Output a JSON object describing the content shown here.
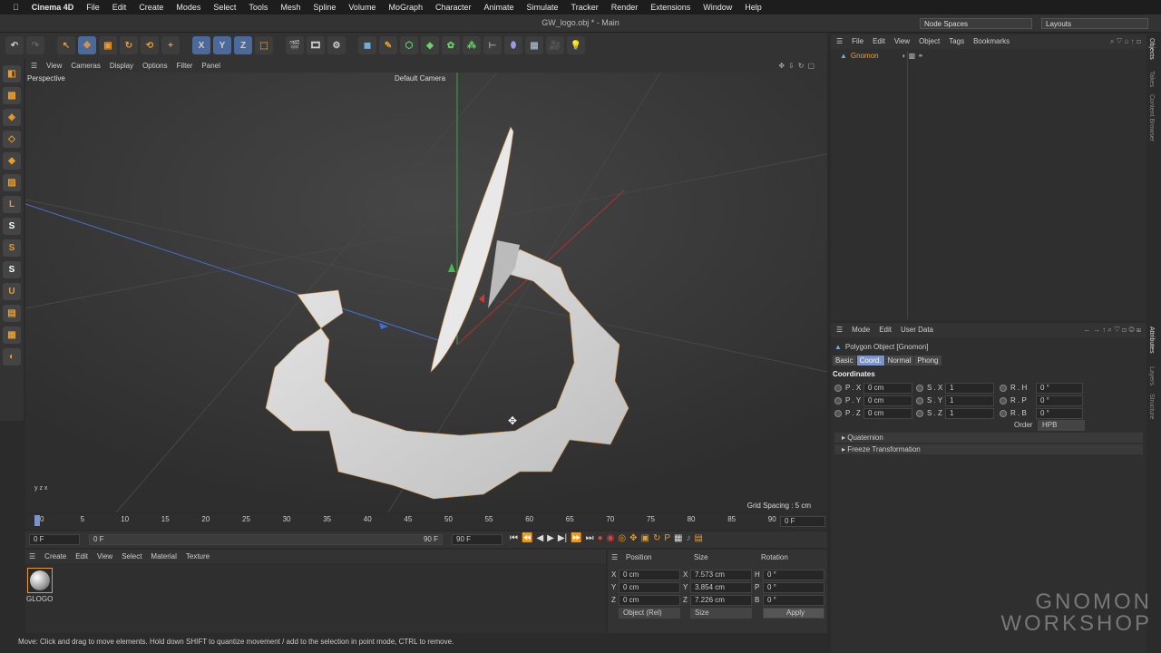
{
  "mac_menu": {
    "app": "Cinema 4D",
    "items": [
      "File",
      "Edit",
      "Create",
      "Modes",
      "Select",
      "Tools",
      "Mesh",
      "Spline",
      "Volume",
      "MoGraph",
      "Character",
      "Animate",
      "Simulate",
      "Tracker",
      "Render",
      "Extensions",
      "Window",
      "Help"
    ]
  },
  "window": {
    "title": "GW_logo.obj * - Main",
    "node_spaces": "Node Spaces",
    "layouts": "Layouts"
  },
  "toolbar": {
    "axis_labels": [
      "X",
      "Y",
      "Z"
    ]
  },
  "viewport": {
    "menu": [
      "View",
      "Cameras",
      "Display",
      "Options",
      "Filter",
      "Panel"
    ],
    "view_name": "Perspective",
    "camera": "Default Camera",
    "grid_spacing": "Grid Spacing : 5 cm"
  },
  "timeline": {
    "ticks": [
      "0",
      "5",
      "10",
      "15",
      "20",
      "25",
      "30",
      "35",
      "40",
      "45",
      "50",
      "55",
      "60",
      "65",
      "70",
      "75",
      "80",
      "85",
      "90"
    ],
    "current_frame": "0 F",
    "start": "0 F",
    "range_start": "0 F",
    "range_end": "90 F",
    "end": "90 F"
  },
  "material_manager": {
    "menu": [
      "Create",
      "Edit",
      "View",
      "Select",
      "Material",
      "Texture"
    ],
    "materials": [
      {
        "name": "GLOGO"
      }
    ]
  },
  "coordinates": {
    "headers": [
      "Position",
      "Size",
      "Rotation"
    ],
    "rows": [
      {
        "axis": "X",
        "pos": "0 cm",
        "size_axis": "X",
        "size": "7.573 cm",
        "rot_axis": "H",
        "rot": "0 °"
      },
      {
        "axis": "Y",
        "pos": "0 cm",
        "size_axis": "Y",
        "size": "3.854 cm",
        "rot_axis": "P",
        "rot": "0 °"
      },
      {
        "axis": "Z",
        "pos": "0 cm",
        "size_axis": "Z",
        "size": "7.226 cm",
        "rot_axis": "B",
        "rot": "0 °"
      }
    ],
    "mode": "Object (Rel)",
    "size_mode": "Size",
    "apply": "Apply"
  },
  "status": "Move: Click and drag to move elements. Hold down SHIFT to quantize movement / add to the selection in point mode, CTRL to remove.",
  "objects": {
    "menu": [
      "File",
      "Edit",
      "View",
      "Object",
      "Tags",
      "Bookmarks"
    ],
    "items": [
      {
        "name": "Gnomon"
      }
    ]
  },
  "attributes": {
    "menu": [
      "Mode",
      "Edit",
      "User Data"
    ],
    "object": "Polygon Object [Gnomon]",
    "tabs": [
      "Basic",
      "Coord.",
      "Normal",
      "Phong"
    ],
    "active_tab": "Coord.",
    "section": "Coordinates",
    "rows": [
      {
        "p": "P . X",
        "pv": "0 cm",
        "s": "S . X",
        "sv": "1",
        "r": "R . H",
        "rv": "0 °"
      },
      {
        "p": "P . Y",
        "pv": "0 cm",
        "s": "S . Y",
        "sv": "1",
        "r": "R . P",
        "rv": "0 °"
      },
      {
        "p": "P . Z",
        "pv": "0 cm",
        "s": "S . Z",
        "sv": "1",
        "r": "R . B",
        "rv": "0 °"
      }
    ],
    "order_label": "Order",
    "order": "HPB",
    "collapsed": [
      "Quaternion",
      "Freeze Transformation"
    ]
  },
  "side_tabs": {
    "top": [
      "Objects",
      "Takes",
      "Content Browser"
    ],
    "bottom": [
      "Attributes",
      "Layers",
      "Structure"
    ]
  },
  "watermark": "THE GNOMON WORKSHOP",
  "colors": {
    "accent": "#4b6a9b",
    "orange": "#ea9b2a",
    "selection": "#f0a030"
  }
}
